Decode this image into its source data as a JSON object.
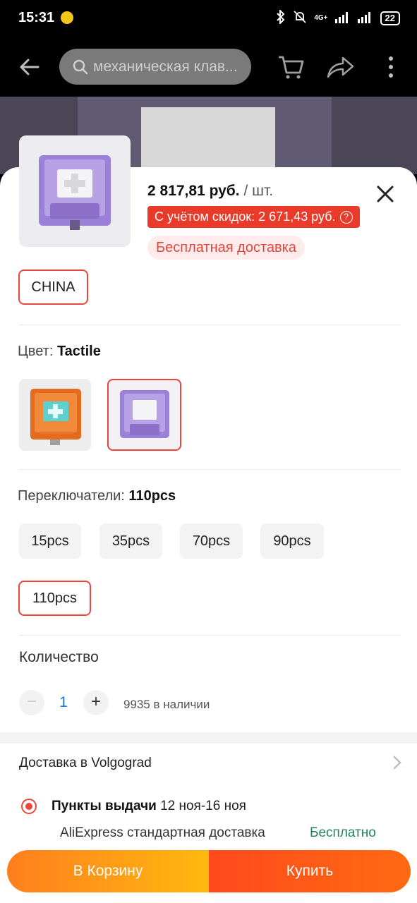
{
  "status": {
    "time": "15:31",
    "network": "4G+",
    "battery": "22"
  },
  "topbar": {
    "search_placeholder": "механическая клав..."
  },
  "product": {
    "price": "2 817,81 руб.",
    "unit": "/ шт.",
    "discount_text": "С учётом скидок: 2 671,43 руб.",
    "free_shipping": "Бесплатная доставка"
  },
  "ship_from": {
    "selected": "CHINA"
  },
  "color": {
    "label": "Цвет:",
    "selected": "Tactile"
  },
  "switches": {
    "label": "Переключатели:",
    "selected": "110pcs",
    "options": [
      "15pcs",
      "35pcs",
      "70pcs",
      "90pcs",
      "110pcs"
    ]
  },
  "quantity": {
    "label": "Количество",
    "minus": "−",
    "plus": "+",
    "value": "1",
    "stock": "9935 в наличии"
  },
  "delivery": {
    "title": "Доставка в Volgograd",
    "method_bold": "Пункты выдачи",
    "dates": "12 ноя-16 ноя",
    "service": "AliExpress стандартная доставка",
    "price": "Бесплатно"
  },
  "actions": {
    "add_to_cart": "В Корзину",
    "buy": "Купить"
  },
  "colors": {
    "accent": "#e9473c",
    "cart_gradient_start": "#ff7e1e",
    "cart_gradient_end": "#ffb90f",
    "buy_color": "#ff5218"
  }
}
